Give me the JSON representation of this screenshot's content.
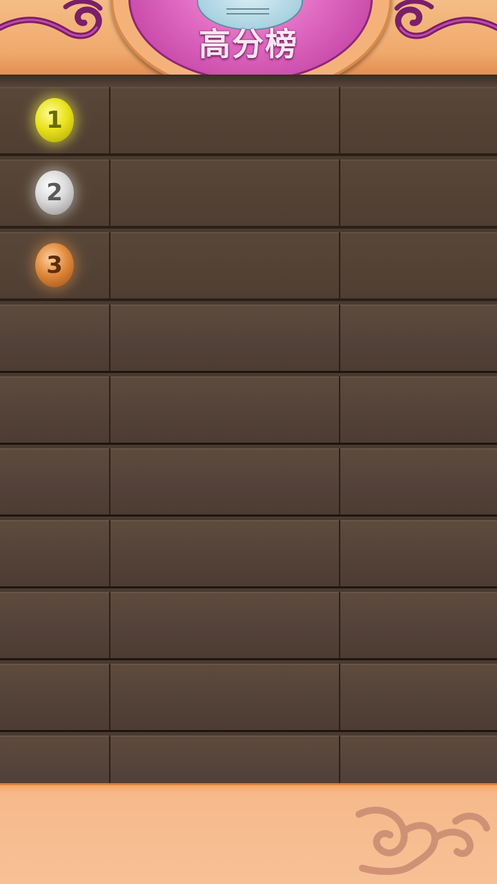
{
  "header": {
    "title": "高分榜"
  },
  "leaderboard": {
    "rows": [
      {
        "rank": "1",
        "medal": "gold",
        "name": "",
        "score": ""
      },
      {
        "rank": "2",
        "medal": "silver",
        "name": "",
        "score": ""
      },
      {
        "rank": "3",
        "medal": "bronze",
        "name": "",
        "score": ""
      },
      {
        "rank": "",
        "medal": "",
        "name": "",
        "score": ""
      },
      {
        "rank": "",
        "medal": "",
        "name": "",
        "score": ""
      },
      {
        "rank": "",
        "medal": "",
        "name": "",
        "score": ""
      },
      {
        "rank": "",
        "medal": "",
        "name": "",
        "score": ""
      },
      {
        "rank": "",
        "medal": "",
        "name": "",
        "score": ""
      },
      {
        "rank": "",
        "medal": "",
        "name": "",
        "score": ""
      },
      {
        "rank": "",
        "medal": "",
        "name": "",
        "score": ""
      }
    ]
  },
  "colors": {
    "banner": "#f0a96c",
    "title_badge": "#e06bc1",
    "row_wood": "#54433a",
    "gold": "#e9e21c",
    "silver": "#d8d8d8",
    "bronze": "#e08a3c"
  },
  "icons": {
    "header_left": "scroll-ornament-icon",
    "header_right": "scroll-ornament-icon",
    "footer": "cloud-swirl-icon"
  }
}
